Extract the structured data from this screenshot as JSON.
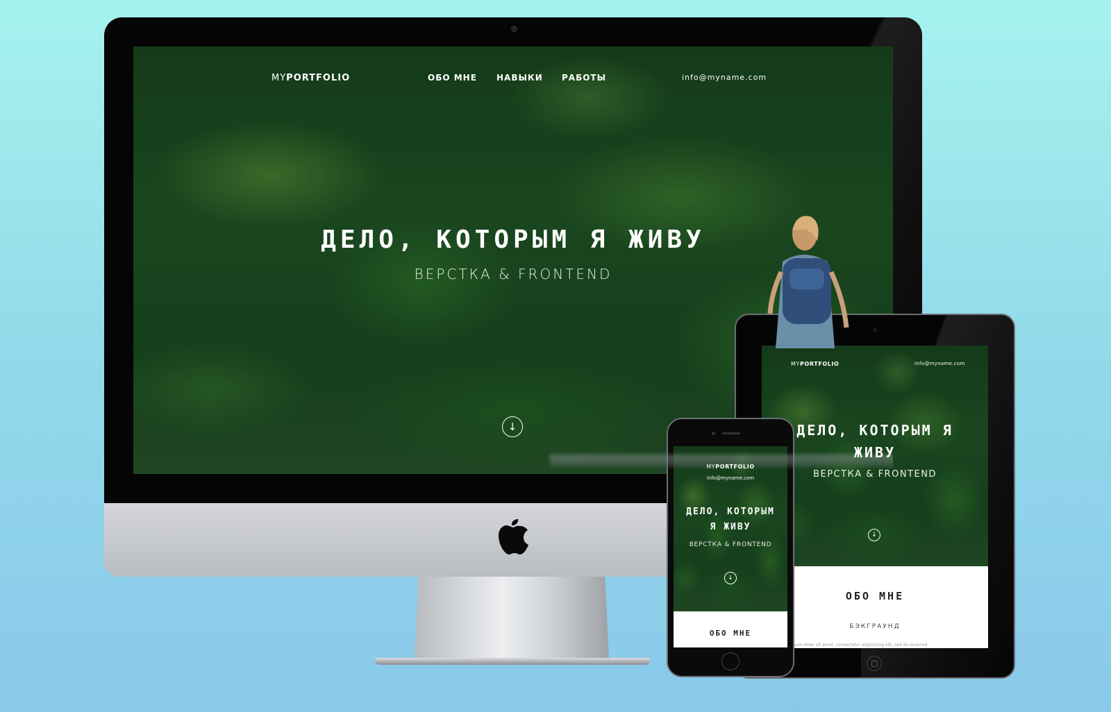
{
  "site": {
    "logo_prefix": "MY",
    "logo_main": "PORTFOLIO",
    "email": "info@myname.com",
    "nav": [
      {
        "label": "ОБО МНЕ"
      },
      {
        "label": "НАВЫКИ"
      },
      {
        "label": "РАБОТЫ"
      }
    ],
    "hero_title": "ДЕЛО, КОТОРЫМ Я ЖИВУ",
    "hero_title_line1": "ДЕЛО, КОТОРЫМ Я",
    "hero_title_line2": "ЖИВУ",
    "iphone_title_line1": "ДЕЛО, КОТОРЫМ",
    "iphone_title_line2": "Я ЖИВУ",
    "hero_subtitle": "ВЕРСТКА & FRONTEND",
    "scroll_arrow": "↓",
    "about_heading": "ОБО МНЕ",
    "background_heading": "БЭКГРАУНД",
    "lorem": "Lorem ipsum dolor sit amet, consectetur adipisicing elit, sed do eiusmod"
  },
  "colors": {
    "background_top": "#a5f3ee",
    "background_bottom": "#8ac9ea",
    "forest_dark": "#1d4a22",
    "device_black": "#050505",
    "imac_chin": "#c6c9cd"
  },
  "icons": {
    "apple_logo": "apple-logo-icon",
    "scroll_down": "arrow-down-circle-icon"
  }
}
